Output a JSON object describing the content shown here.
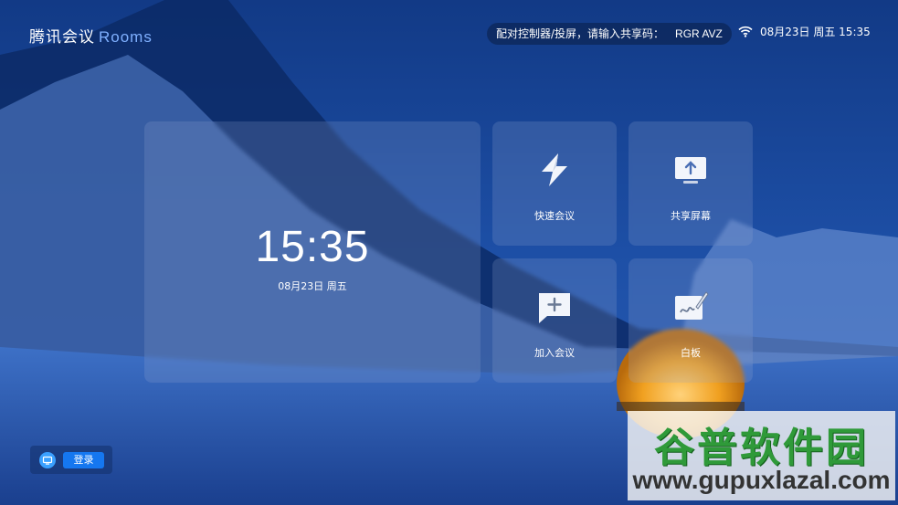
{
  "brand": {
    "cn": "腾讯会议",
    "en": "Rooms"
  },
  "share": {
    "prompt": "配对控制器/投屏，请输入共享码：",
    "code": "RGR AVZ"
  },
  "status": {
    "datetime": "08月23日 周五 15:35"
  },
  "clock": {
    "time": "15:35",
    "date": "08月23日 周五"
  },
  "actions": [
    {
      "label": "快速会议",
      "icon": "lightning-icon"
    },
    {
      "label": "共享屏幕",
      "icon": "share-screen-icon"
    },
    {
      "label": "加入会议",
      "icon": "join-meeting-icon"
    },
    {
      "label": "白板",
      "icon": "whiteboard-icon"
    }
  ],
  "login": {
    "label": "登录"
  },
  "watermark": {
    "cn": "谷普软件园",
    "url": "www.gupuxlazal.com"
  },
  "colors": {
    "accent": "#1577f0",
    "brand_en": "#7fb0ff",
    "watermark_green": "#2f9a39"
  }
}
